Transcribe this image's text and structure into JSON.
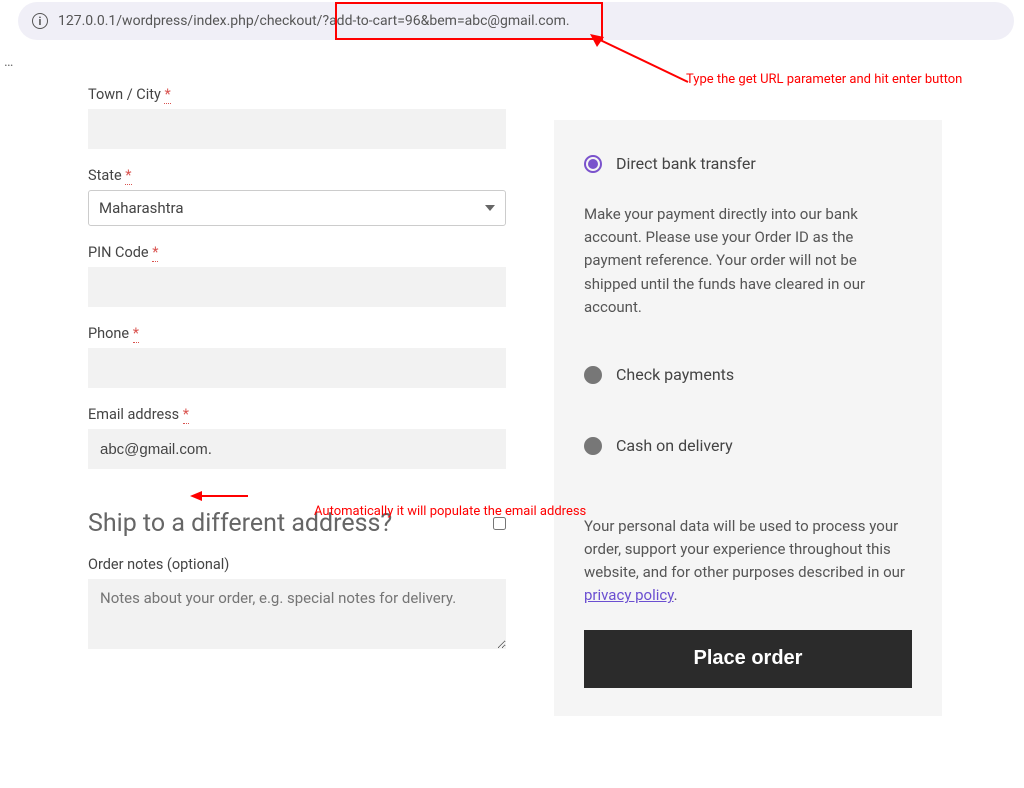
{
  "address_bar": {
    "url": "127.0.0.1/wordpress/index.php/checkout/?add-to-cart=96&bem=abc@gmail.com."
  },
  "annotations": {
    "top_arrow_text": "Type the get URL parameter and hit enter button",
    "mid_arrow_text": "Automatically it will populate the email address"
  },
  "billing": {
    "town_label": "Town / City",
    "town_value": "",
    "state_label": "State",
    "state_value": "Maharashtra",
    "pin_label": "PIN Code",
    "pin_value": "",
    "phone_label": "Phone",
    "phone_value": "",
    "email_label": "Email address",
    "email_value": "abc@gmail.com.",
    "required_mark": "*"
  },
  "shipping": {
    "heading": "Ship to a different address?",
    "notes_label": "Order notes (optional)",
    "notes_placeholder": "Notes about your order, e.g. special notes for delivery."
  },
  "payment": {
    "direct_bank": "Direct bank transfer",
    "direct_bank_desc": "Make your payment directly into our bank account. Please use your Order ID as the payment reference. Your order will not be shipped until the funds have cleared in our account.",
    "check": "Check payments",
    "cod": "Cash on delivery",
    "privacy_text_pre": "Your personal data will be used to process your order, support your experience throughout this website, and for other purposes described in our ",
    "privacy_link": "privacy policy",
    "privacy_text_post": ".",
    "place_order": "Place order"
  }
}
